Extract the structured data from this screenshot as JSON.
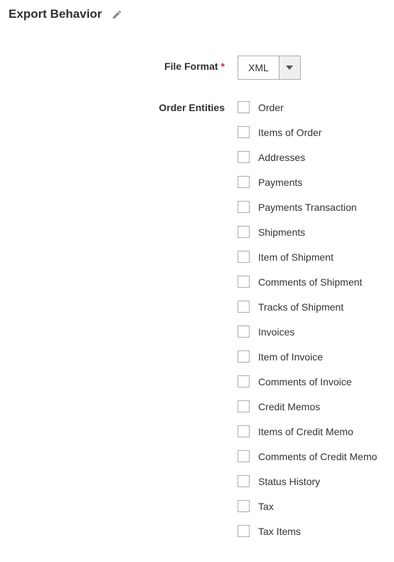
{
  "section": {
    "title": "Export Behavior"
  },
  "fileFormat": {
    "label": "File Format",
    "value": "XML"
  },
  "orderEntities": {
    "label": "Order Entities",
    "items": [
      {
        "label": "Order"
      },
      {
        "label": "Items of Order"
      },
      {
        "label": "Addresses"
      },
      {
        "label": "Payments"
      },
      {
        "label": "Payments Transaction"
      },
      {
        "label": "Shipments"
      },
      {
        "label": "Item of Shipment"
      },
      {
        "label": "Comments of Shipment"
      },
      {
        "label": "Tracks of Shipment"
      },
      {
        "label": "Invoices"
      },
      {
        "label": "Item of Invoice"
      },
      {
        "label": "Comments of Invoice"
      },
      {
        "label": "Credit Memos"
      },
      {
        "label": "Items of Credit Memo"
      },
      {
        "label": "Comments of Credit Memo"
      },
      {
        "label": "Status History"
      },
      {
        "label": "Tax"
      },
      {
        "label": "Tax Items"
      }
    ]
  }
}
